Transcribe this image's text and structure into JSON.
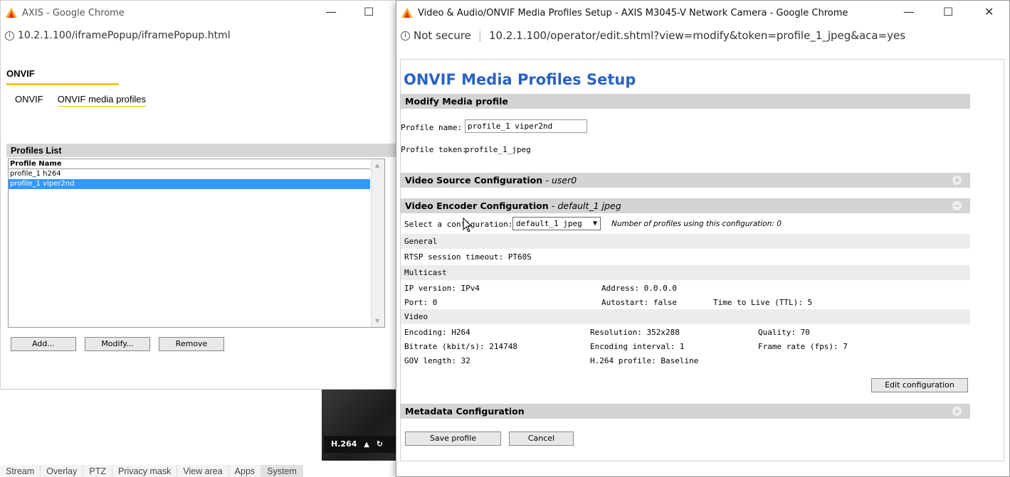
{
  "bg_window": {
    "title": "AXIS - Google Chrome",
    "url": "10.2.1.100/iframePopup/iframePopup.html",
    "heading": "ONVIF",
    "tabs": [
      "ONVIF",
      "ONVIF media profiles"
    ],
    "profiles_list": {
      "title": "Profiles List",
      "column_header": "Profile Name",
      "rows": [
        "profile_1 h264",
        "profile_1 viper2nd"
      ],
      "selected_index": 1
    },
    "buttons": {
      "add": "Add...",
      "modify": "Modify...",
      "remove": "Remove"
    },
    "video_overlay_label": "H.264",
    "bottom_tabs": [
      "Stream",
      "Overlay",
      "PTZ",
      "Privacy mask",
      "View area",
      "Apps",
      "System"
    ],
    "bottom_active_tab": "System"
  },
  "popup": {
    "title": "Video & Audio/ONVIF Media Profiles Setup - AXIS M3045-V Network Camera - Google Chrome",
    "not_secure": "Not secure",
    "url": "10.2.1.100/operator/edit.shtml?view=modify&token=profile_1_jpeg&aca=yes",
    "page_title": "ONVIF Media Profiles Setup",
    "modify_section": "Modify Media profile",
    "profile_name_label": "Profile name:",
    "profile_name_value": "profile_1 viper2nd",
    "profile_token_label": "Profile token:",
    "profile_token_value": "profile_1_jpeg",
    "video_source": {
      "label": "Video Source Configuration",
      "suffix": "- user0"
    },
    "video_encoder": {
      "label": "Video Encoder Configuration",
      "suffix": "- default_1 jpeg"
    },
    "select_config_label": "Select a configuration:",
    "select_config_value": "default_1 jpeg",
    "profiles_using_note": "Number of profiles using this configuration: 0",
    "general": {
      "title": "General",
      "rtsp": "RTSP session timeout: PT60S"
    },
    "multicast": {
      "title": "Multicast",
      "ip_version": "IP version: IPv4",
      "address": "Address: 0.0.0.0",
      "port": "Port: 0",
      "autostart": "Autostart: false",
      "ttl": "Time to Live (TTL): 5"
    },
    "video": {
      "title": "Video",
      "encoding": "Encoding: H264",
      "resolution": "Resolution: 352x288",
      "quality": "Quality: 70",
      "bitrate": "Bitrate (kbit/s): 214748",
      "encoding_interval": "Encoding interval: 1",
      "frame_rate": "Frame rate (fps): 7",
      "gov_length": "GOV length: 32",
      "h264_profile": "H.264 profile: Baseline"
    },
    "edit_config_button": "Edit configuration",
    "metadata": {
      "label": "Metadata Configuration"
    },
    "save_button": "Save profile",
    "cancel_button": "Cancel",
    "toggle_plus": "+",
    "toggle_minus": "−"
  },
  "colors": {
    "accent_yellow": "#f5c518",
    "title_blue": "#2962c4",
    "selection_blue": "#3399ff"
  }
}
